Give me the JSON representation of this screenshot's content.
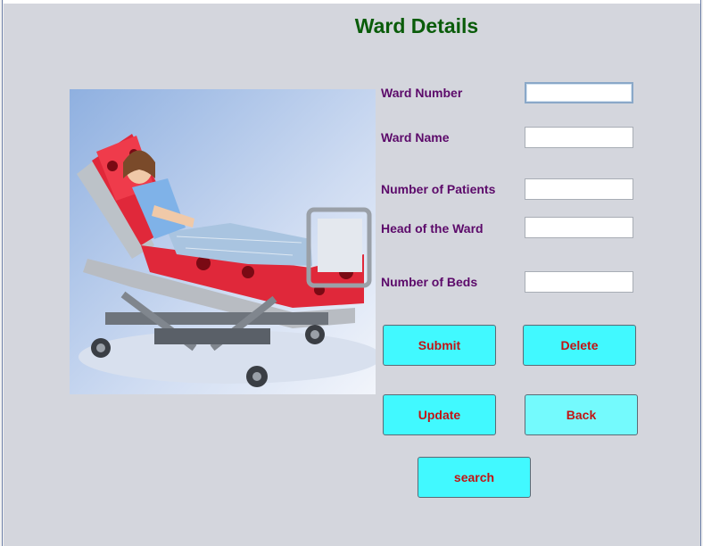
{
  "form": {
    "title": "Ward Details",
    "fields": [
      {
        "label": "Ward Number",
        "value": "",
        "focused": true
      },
      {
        "label": "Ward Name",
        "value": ""
      },
      {
        "label": "Number of Patients",
        "value": ""
      },
      {
        "label": "Head of the Ward",
        "value": ""
      },
      {
        "label": "Number of Beds",
        "value": ""
      }
    ],
    "buttons": {
      "submit": "Submit",
      "delete": "Delete",
      "update": "Update",
      "back": "Back",
      "search": "search"
    }
  },
  "colors": {
    "background": "#d4d6dd",
    "title": "#0a5c0a",
    "label": "#5c0a6a",
    "button_bg": "#41f9ff",
    "button_text": "#c21414"
  }
}
